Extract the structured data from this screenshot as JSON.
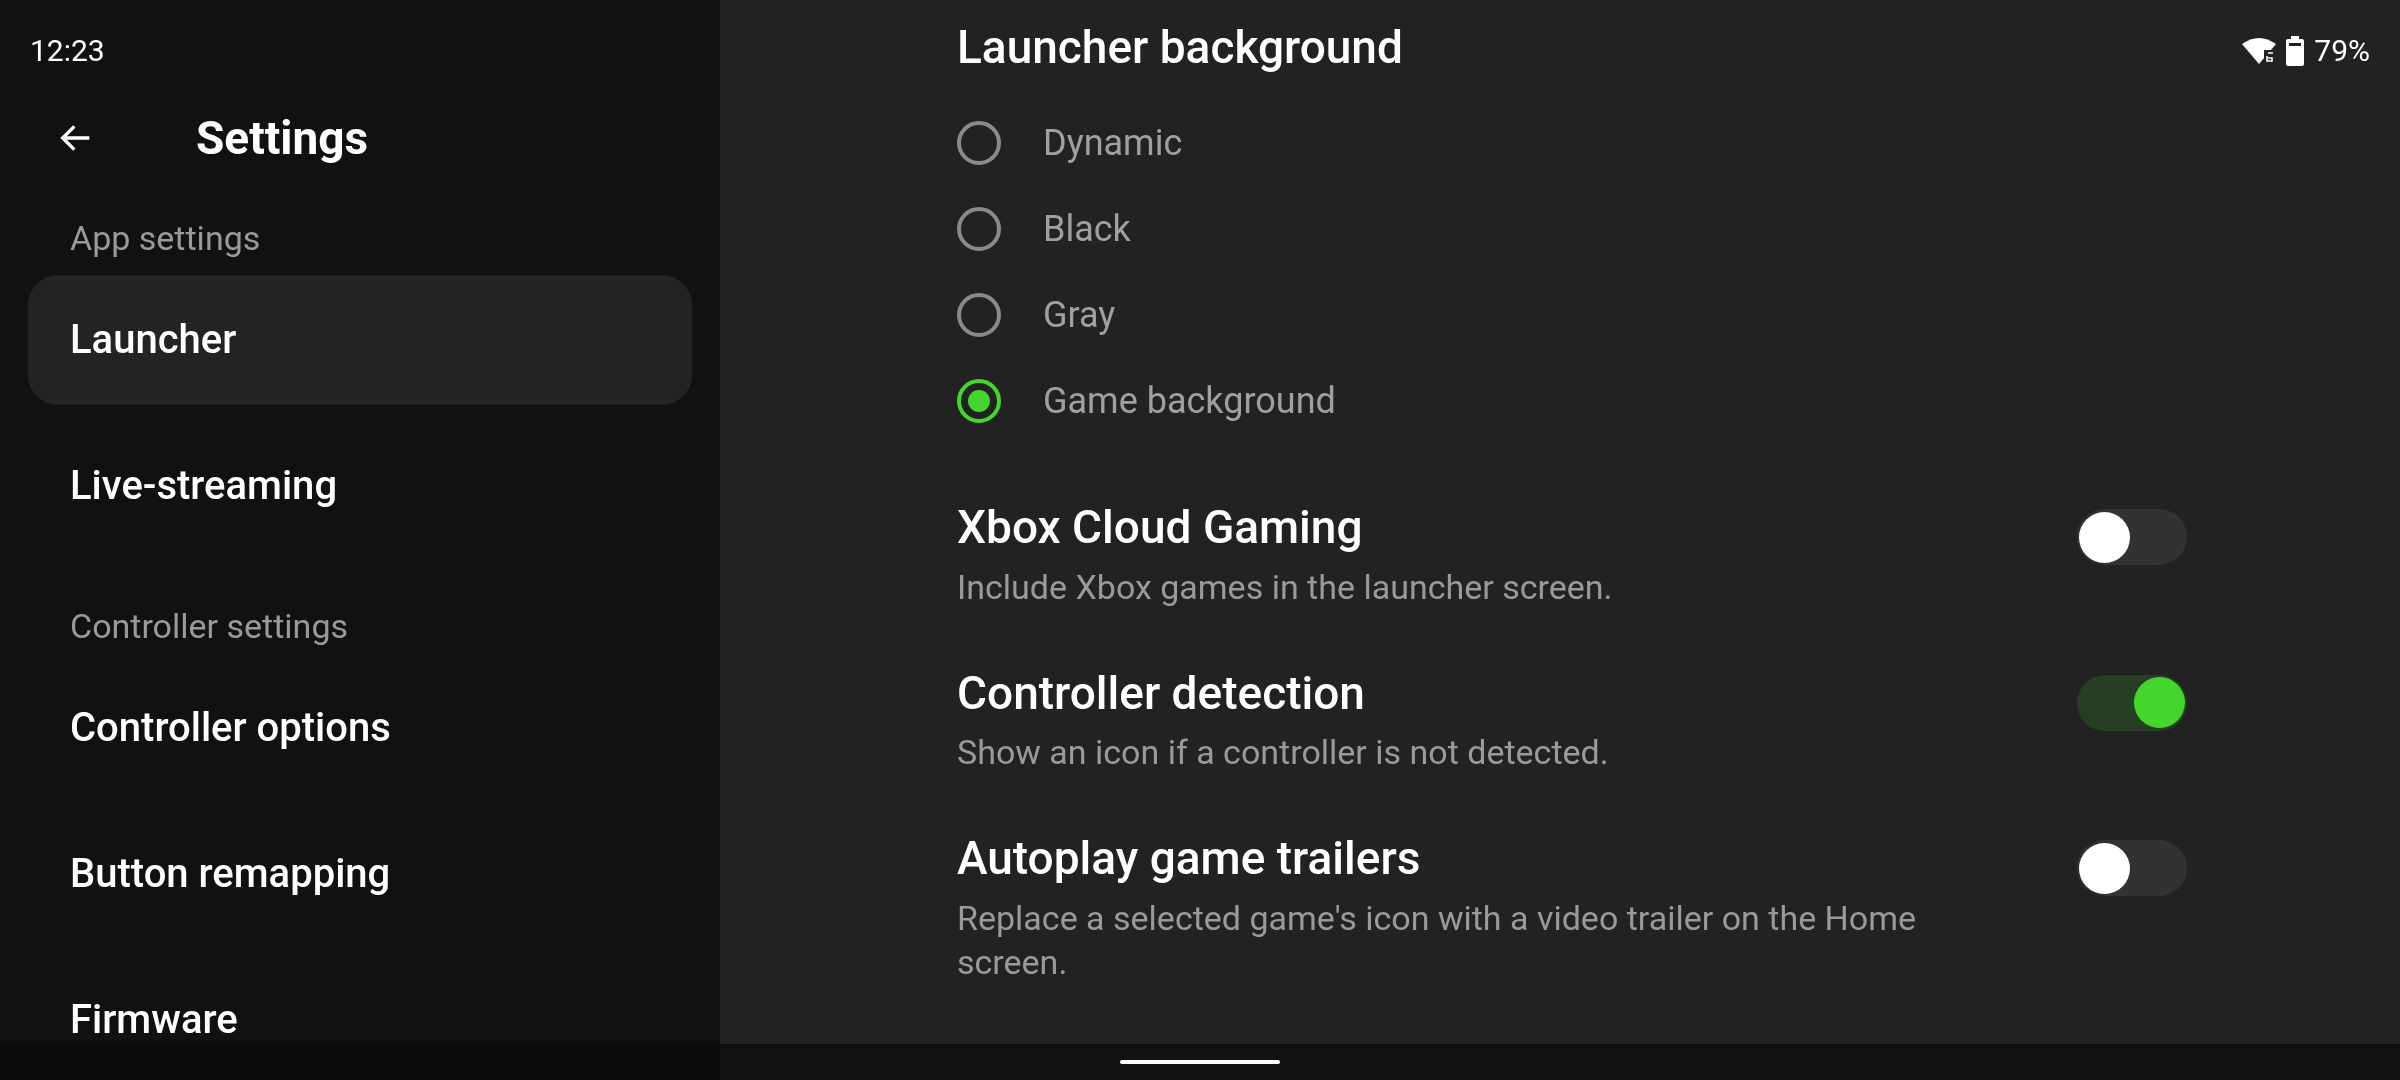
{
  "status_bar": {
    "time": "12:23",
    "battery": "79%"
  },
  "sidebar": {
    "title": "Settings",
    "sections": [
      {
        "heading": "App settings",
        "items": [
          {
            "label": "Launcher",
            "selected": true
          },
          {
            "label": "Live-streaming",
            "selected": false
          }
        ]
      },
      {
        "heading": "Controller settings",
        "items": [
          {
            "label": "Controller options",
            "selected": false
          },
          {
            "label": "Button remapping",
            "selected": false
          },
          {
            "label": "Firmware",
            "selected": false
          }
        ]
      }
    ]
  },
  "launcher_background": {
    "title": "Launcher background",
    "options": [
      {
        "label": "Dynamic",
        "selected": false
      },
      {
        "label": "Black",
        "selected": false
      },
      {
        "label": "Gray",
        "selected": false
      },
      {
        "label": "Game background",
        "selected": true
      }
    ]
  },
  "toggles": [
    {
      "title": "Xbox Cloud Gaming",
      "description": "Include Xbox games in the launcher screen.",
      "on": false
    },
    {
      "title": "Controller detection",
      "description": "Show an icon if a controller is not detected.",
      "on": true
    },
    {
      "title": "Autoplay game trailers",
      "description": "Replace a selected game's icon with a video trailer on the Home screen.",
      "on": false
    }
  ]
}
